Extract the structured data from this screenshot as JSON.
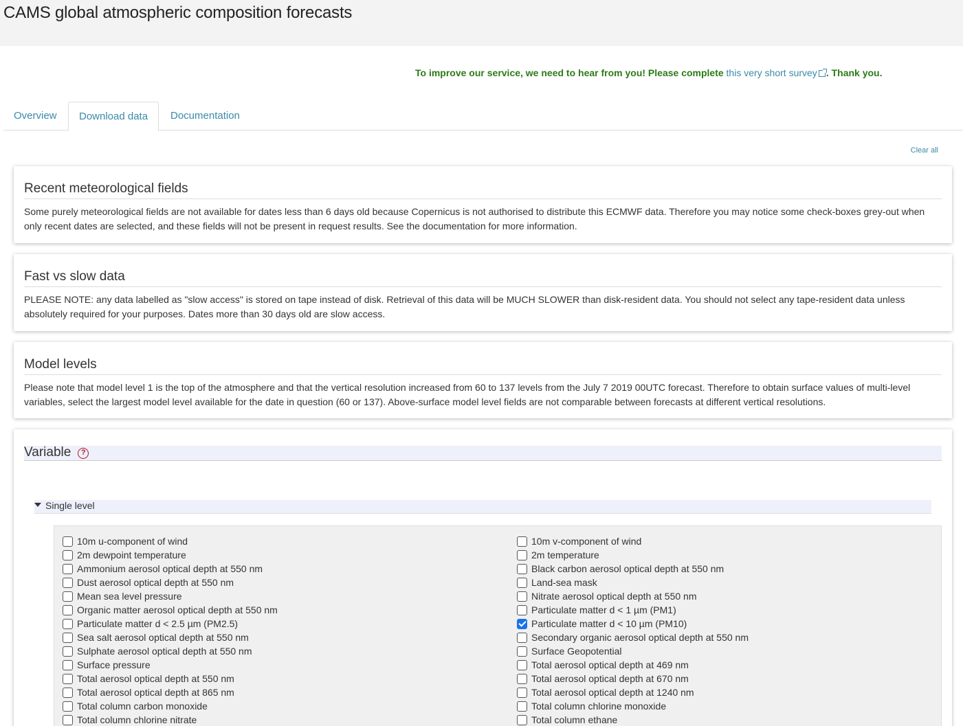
{
  "page": {
    "title": "CAMS global atmospheric composition forecasts"
  },
  "survey": {
    "prefix": "To improve our service, we need to hear from you! Please complete ",
    "link": "this very short survey",
    "suffix": ". Thank you."
  },
  "tabs": [
    {
      "label": "Overview"
    },
    {
      "label": "Download data",
      "active": true
    },
    {
      "label": "Documentation"
    }
  ],
  "clear_all": "Clear all",
  "cards": [
    {
      "title": "Recent meteorological fields",
      "text": "Some purely meteorological fields are not available for dates less than 6 days old because Copernicus is not authorised to distribute this ECMWF data. Therefore you may notice some check-boxes grey-out when only recent dates are selected, and these fields will not be present in request results. See the documentation for more information."
    },
    {
      "title": "Fast vs slow data",
      "text": "PLEASE NOTE: any data labelled as \"slow access\" is stored on tape instead of disk. Retrieval of this data will be MUCH SLOWER than disk-resident data. You should not select any tape-resident data unless absolutely required for your purposes. Dates more than 30 days old are slow access."
    },
    {
      "title": "Model levels",
      "text": "Please note that model level 1 is the top of the atmosphere and that the vertical resolution increased from 60 to 137 levels from the July 7 2019 00UTC forecast. Therefore to obtain surface values of multi-level variables, select the largest model level available for the date in question (60 or 137). Above-surface model level fields are not comparable between forecasts at different vertical resolutions."
    }
  ],
  "variable": {
    "title": "Variable",
    "help_icon": "question-circle-icon",
    "subgroup": "Single level",
    "left": [
      {
        "label": "10m u-component of wind",
        "checked": false
      },
      {
        "label": "2m dewpoint temperature",
        "checked": false
      },
      {
        "label": "Ammonium aerosol optical depth at 550 nm",
        "checked": false
      },
      {
        "label": "Dust aerosol optical depth at 550 nm",
        "checked": false
      },
      {
        "label": "Mean sea level pressure",
        "checked": false
      },
      {
        "label": "Organic matter aerosol optical depth at 550 nm",
        "checked": false
      },
      {
        "label": "Particulate matter d < 2.5 µm (PM2.5)",
        "checked": false
      },
      {
        "label": "Sea salt aerosol optical depth at 550 nm",
        "checked": false
      },
      {
        "label": "Sulphate aerosol optical depth at 550 nm",
        "checked": false
      },
      {
        "label": "Surface pressure",
        "checked": false
      },
      {
        "label": "Total aerosol optical depth at 550 nm",
        "checked": false
      },
      {
        "label": "Total aerosol optical depth at 865 nm",
        "checked": false
      },
      {
        "label": "Total column carbon monoxide",
        "checked": false
      },
      {
        "label": "Total column chlorine nitrate",
        "checked": false
      }
    ],
    "right": [
      {
        "label": "10m v-component of wind",
        "checked": false
      },
      {
        "label": "2m temperature",
        "checked": false
      },
      {
        "label": "Black carbon aerosol optical depth at 550 nm",
        "checked": false
      },
      {
        "label": "Land-sea mask",
        "checked": false
      },
      {
        "label": "Nitrate aerosol optical depth at 550 nm",
        "checked": false
      },
      {
        "label": "Particulate matter d < 1 µm (PM1)",
        "checked": false
      },
      {
        "label": "Particulate matter d < 10 µm (PM10)",
        "checked": true
      },
      {
        "label": "Secondary organic aerosol optical depth at 550 nm",
        "checked": false
      },
      {
        "label": "Surface Geopotential",
        "checked": false
      },
      {
        "label": "Total aerosol optical depth at 469 nm",
        "checked": false
      },
      {
        "label": "Total aerosol optical depth at 670 nm",
        "checked": false
      },
      {
        "label": "Total aerosol optical depth at 1240 nm",
        "checked": false
      },
      {
        "label": "Total column chlorine monoxide",
        "checked": false
      },
      {
        "label": "Total column ethane",
        "checked": false
      }
    ]
  }
}
